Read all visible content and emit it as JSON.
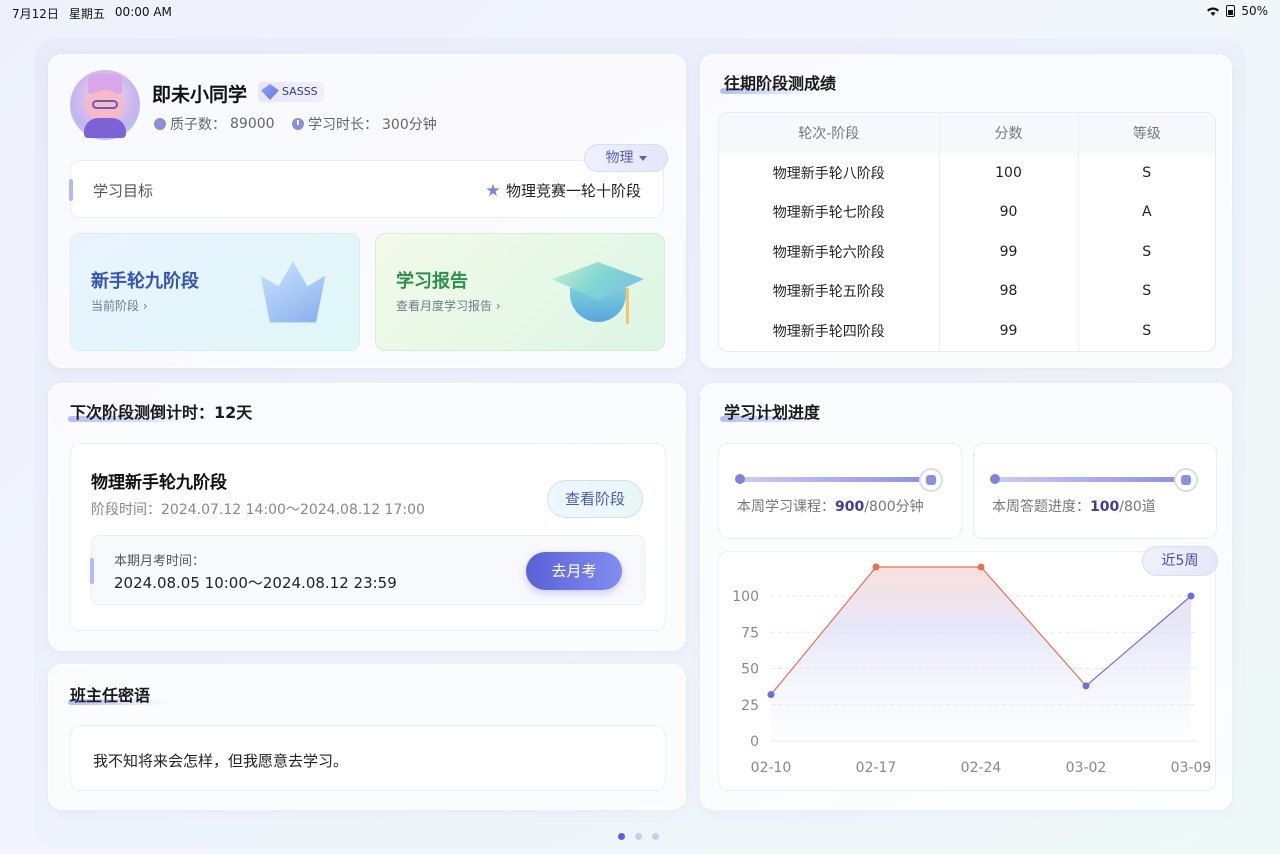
{
  "status_bar": {
    "date": "7月12日",
    "weekday": "星期五",
    "time": "00:00 AM",
    "battery": "50%"
  },
  "profile": {
    "name": "即未小同学",
    "rank": "SASSS",
    "quark_label": "质子数：",
    "quark_value": "89000",
    "duration_label": "学习时长：",
    "duration_value": "300分钟"
  },
  "goal": {
    "subject": "物理",
    "label": "学习目标",
    "value": "物理竞赛一轮十阶段"
  },
  "tiles": {
    "stage_title": "新手轮九阶段",
    "stage_sub": "当前阶段",
    "report_title": "学习报告",
    "report_sub": "查看月度学习报告"
  },
  "past_scores": {
    "title": "往期阶段测成绩",
    "headers": [
      "轮次-阶段",
      "分数",
      "等级"
    ],
    "rows": [
      [
        "物理新手轮八阶段",
        "100",
        "S"
      ],
      [
        "物理新手轮七阶段",
        "90",
        "A"
      ],
      [
        "物理新手轮六阶段",
        "99",
        "S"
      ],
      [
        "物理新手轮五阶段",
        "98",
        "S"
      ],
      [
        "物理新手轮四阶段",
        "99",
        "S"
      ]
    ]
  },
  "countdown": {
    "title": "下次阶段测倒计时：12天",
    "stage_name": "物理新手轮九阶段",
    "stage_time": "阶段时间：2024.07.12 14:00～2024.08.12 17:00",
    "view_button": "查看阶段",
    "monthly_label": "本期月考时间：",
    "monthly_value": "2024.08.05 10:00～2024.08.12 23:59",
    "exam_button": "去月考"
  },
  "teacher": {
    "title": "班主任密语",
    "message": "我不知将来会怎样，但我愿意去学习。"
  },
  "plan": {
    "title": "学习计划进度",
    "course_label": "本周学习课程：",
    "course_value": "900",
    "course_total": "/800分钟",
    "course_progress": 1.0,
    "quiz_label": "本周答题进度：",
    "quiz_value": "100",
    "quiz_total": "/80道",
    "quiz_progress": 1.0,
    "range_button": "近5周"
  },
  "chart_data": {
    "type": "line",
    "x": [
      "02-10",
      "02-17",
      "02-24",
      "03-02",
      "03-09"
    ],
    "values": [
      32,
      120,
      120,
      38,
      100
    ],
    "yticks": [
      0,
      25,
      50,
      75,
      100
    ],
    "ylim": [
      0,
      120
    ],
    "colors": {
      "normal": "#6b6fd6",
      "over": "#e0744f"
    }
  },
  "pager": {
    "pages": 3,
    "active": 0
  }
}
